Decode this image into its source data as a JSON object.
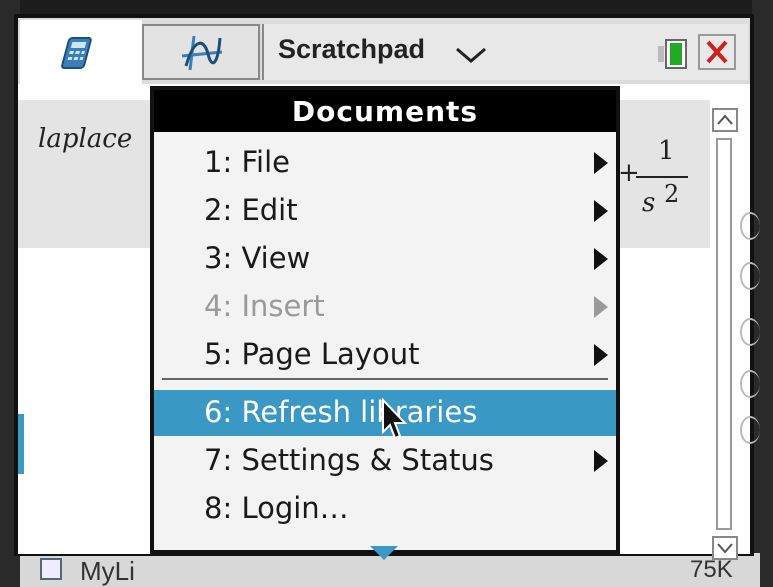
{
  "window": {
    "title": "Scratchpad",
    "tabs": [
      {
        "name": "calculator",
        "icon": "calculator-icon"
      },
      {
        "name": "graphs",
        "icon": "graph-icon"
      }
    ]
  },
  "calculator": {
    "expression_input": "laplace",
    "result_numerator": "1",
    "result_denominator": "s",
    "result_exponent": "2"
  },
  "menu": {
    "title": "Documents",
    "items": [
      {
        "label": "1: File",
        "submenu": true,
        "enabled": true,
        "selected": false
      },
      {
        "label": "2: Edit",
        "submenu": true,
        "enabled": true,
        "selected": false
      },
      {
        "label": "3: View",
        "submenu": true,
        "enabled": true,
        "selected": false
      },
      {
        "label": "4: Insert",
        "submenu": true,
        "enabled": false,
        "selected": false
      },
      {
        "label": "5: Page Layout",
        "submenu": true,
        "enabled": true,
        "selected": false
      },
      {
        "label": "6: Refresh libraries",
        "submenu": false,
        "enabled": true,
        "selected": true
      },
      {
        "label": "7: Settings & Status",
        "submenu": true,
        "enabled": true,
        "selected": false
      },
      {
        "label": "8: Login…",
        "submenu": false,
        "enabled": true,
        "selected": false
      }
    ]
  },
  "background": {
    "bottom_left_text": "MyLi",
    "bottom_right_text": "75K"
  },
  "colors": {
    "accent": "#3a98c4",
    "close_red": "#d02020",
    "battery_green": "#22aa22"
  }
}
